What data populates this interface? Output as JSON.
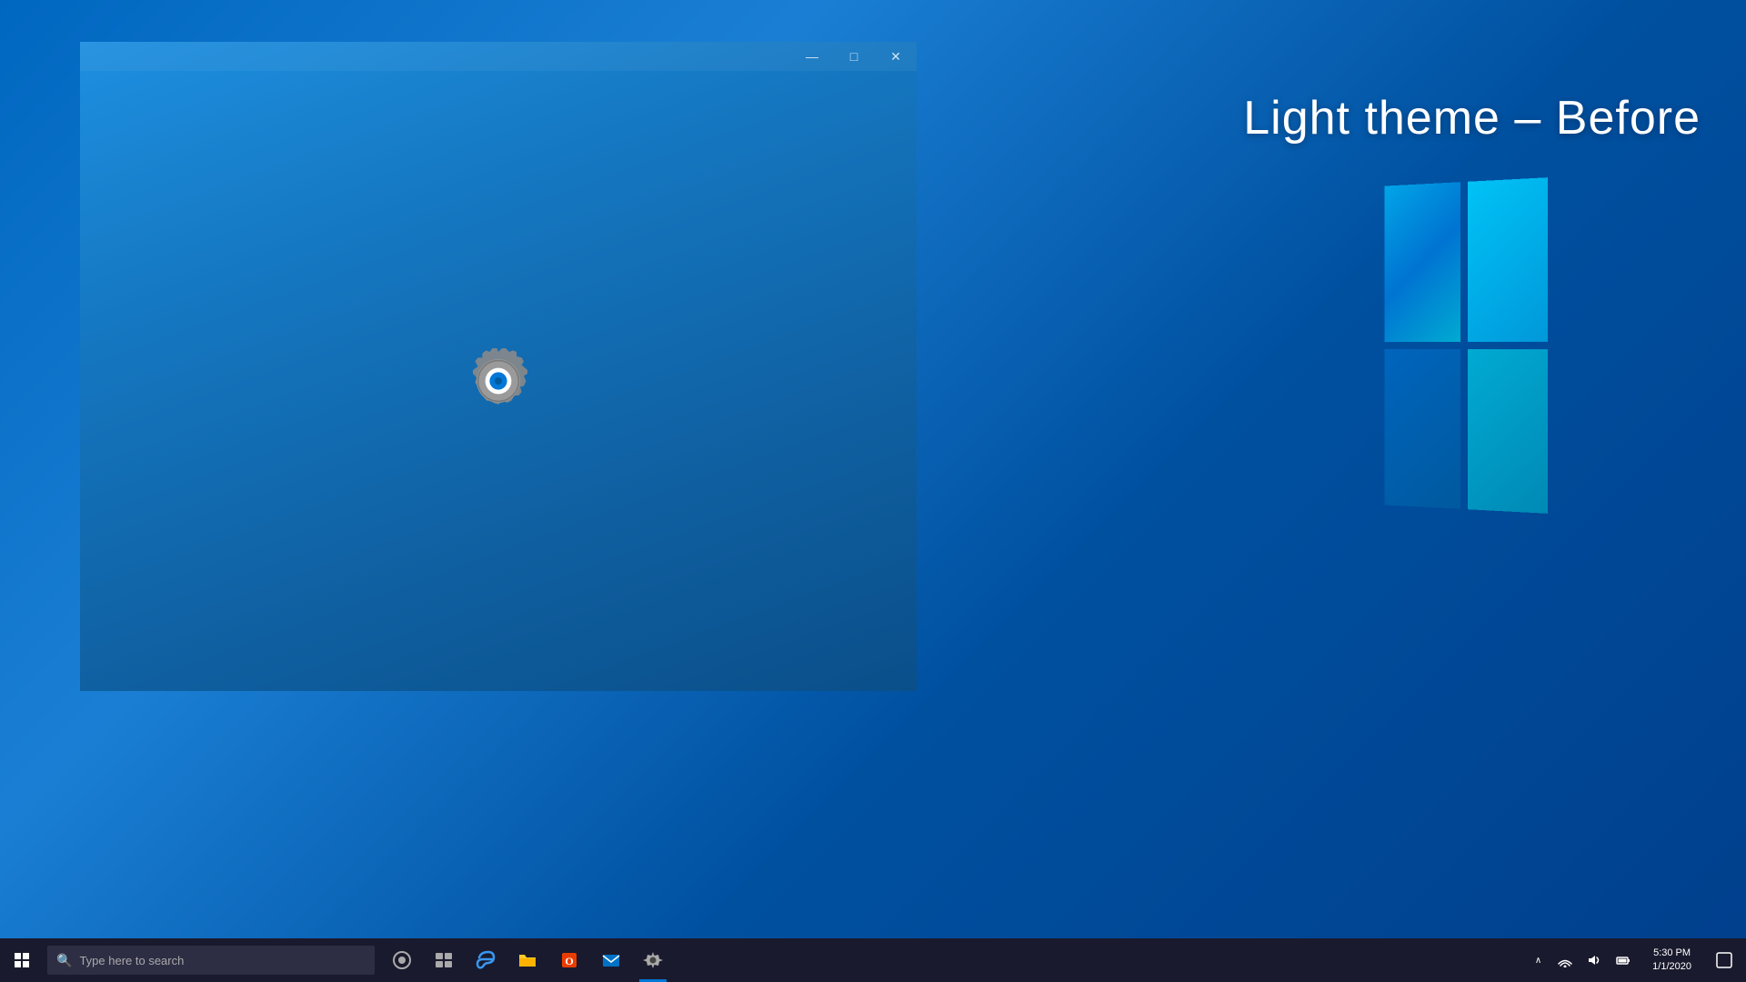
{
  "desktop": {
    "background_color": "#0067c0"
  },
  "annotation": {
    "text": "Light theme – Before"
  },
  "settings_window": {
    "title": "Settings",
    "min_button": "—",
    "max_button": "□",
    "close_button": "✕",
    "loading": true
  },
  "taskbar": {
    "search_placeholder": "Type here to search",
    "icons": [
      {
        "name": "cortana",
        "symbol": "○"
      },
      {
        "name": "task-view",
        "symbol": "⊞"
      },
      {
        "name": "edge",
        "symbol": "e"
      },
      {
        "name": "file-explorer",
        "symbol": "📁"
      },
      {
        "name": "office",
        "symbol": "O"
      },
      {
        "name": "mail",
        "symbol": "✉"
      },
      {
        "name": "settings",
        "symbol": "⚙"
      }
    ],
    "tray_icons": [
      "^",
      "⊟",
      "🔊",
      "📶",
      "🔔"
    ],
    "time": "5:30 PM",
    "date": "1/1/2020",
    "notification_symbol": "🗨"
  },
  "colors": {
    "taskbar_bg": "#1a1a2e",
    "window_bg_start": "#1e8fe0",
    "window_bg_end": "#0a4f8a",
    "accent": "#0078d7"
  }
}
